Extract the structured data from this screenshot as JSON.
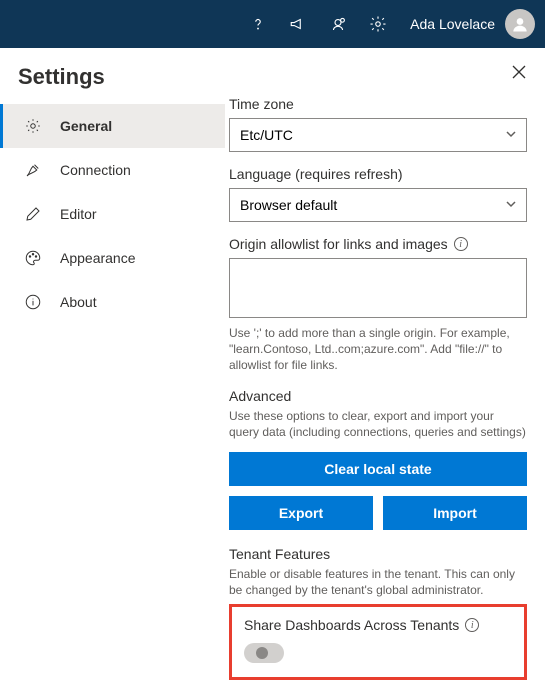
{
  "header": {
    "user_name": "Ada Lovelace"
  },
  "settings": {
    "title": "Settings",
    "nav": [
      {
        "label": "General"
      },
      {
        "label": "Connection"
      },
      {
        "label": "Editor"
      },
      {
        "label": "Appearance"
      },
      {
        "label": "About"
      }
    ],
    "timezone": {
      "label": "Time zone",
      "value": "Etc/UTC"
    },
    "language": {
      "label": "Language (requires refresh)",
      "value": "Browser default"
    },
    "origin": {
      "label": "Origin allowlist for links and images",
      "value": "",
      "hint": "Use ';' to add more than a single origin. For example, \"learn.Contoso, Ltd..com;azure.com\". Add \"file://\" to allowlist for file links."
    },
    "advanced": {
      "title": "Advanced",
      "desc": "Use these options to clear, export and import your query data (including connections, queries and settings)",
      "clear": "Clear local state",
      "export": "Export",
      "import": "Import"
    },
    "tenant": {
      "title": "Tenant Features",
      "desc": "Enable or disable features in the tenant. This can only be changed by the tenant's global administrator.",
      "share_label": "Share Dashboards Across Tenants"
    }
  }
}
